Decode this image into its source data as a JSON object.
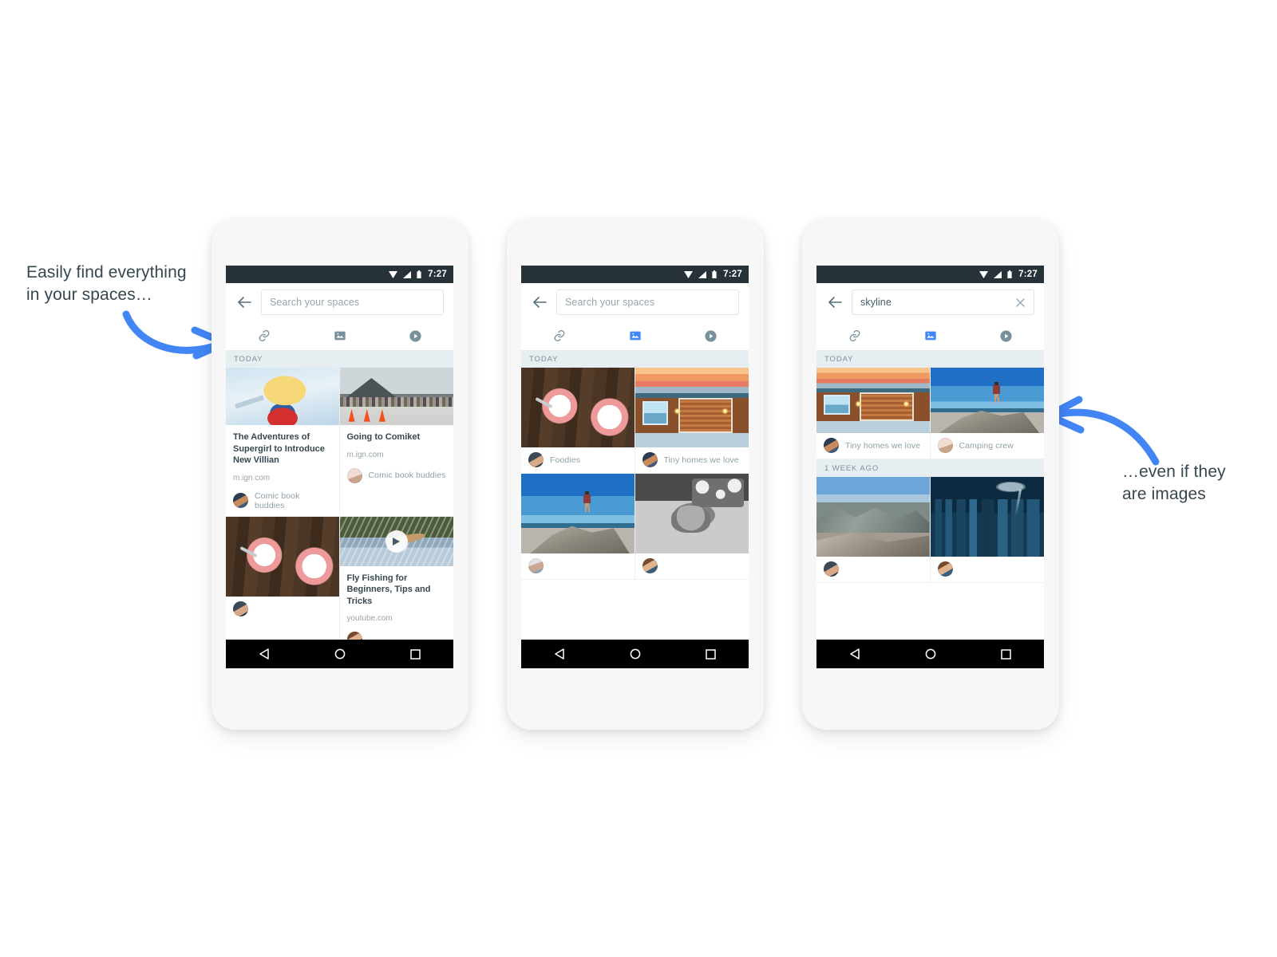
{
  "annotations": {
    "left": "Easily find everything\nin your spaces…",
    "right": "…even if they\nare images",
    "arrow_color": "#4285f4",
    "text_color": "#37474f"
  },
  "status_bar": {
    "time": "7:27",
    "icons": [
      "wifi-icon",
      "signal-icon",
      "battery-icon"
    ],
    "background": "#263238"
  },
  "nav_bar": {
    "back_label": "back-triangle",
    "home_label": "home-circle",
    "recents_label": "recents-square",
    "background": "#000000"
  },
  "tabs": {
    "link": "link-icon",
    "image": "image-icon",
    "video": "video-icon",
    "active_color": "#4285f4",
    "inactive_color": "#78909c"
  },
  "phones": [
    {
      "id": "phone-1",
      "search": {
        "value": "",
        "placeholder": "Search your spaces",
        "has_clear": false
      },
      "active_tab": "none",
      "sections": [
        {
          "label": "TODAY",
          "cards": [
            {
              "type": "link",
              "art": "art-supergirl",
              "title": "The Adventures of Supergirl to Introduce New Villian",
              "source": "m.ign.com",
              "space": "Comic book buddies",
              "avatar": "av1"
            },
            {
              "type": "link",
              "art": "art-comiket",
              "title": "Going to Comiket",
              "source": "m.ign.com",
              "space": "Comic book buddies",
              "avatar": "av2"
            },
            {
              "type": "image",
              "art": "art-food",
              "title": "",
              "source": "",
              "space": "",
              "avatar": "av3"
            },
            {
              "type": "video",
              "art": "art-fish",
              "title": "Fly Fishing for Beginners, Tips and Tricks",
              "source": "youtube.com",
              "space": "",
              "avatar": "av4"
            }
          ]
        }
      ]
    },
    {
      "id": "phone-2",
      "search": {
        "value": "",
        "placeholder": "Search your spaces",
        "has_clear": false
      },
      "active_tab": "image",
      "sections": [
        {
          "label": "TODAY",
          "cards": [
            {
              "type": "image",
              "art": "art-food",
              "title": "",
              "source": "",
              "space": "Foodies",
              "avatar": "av3"
            },
            {
              "type": "image",
              "art": "art-cabin",
              "title": "",
              "source": "",
              "space": "Tiny homes we love",
              "avatar": "av1"
            },
            {
              "type": "image",
              "art": "art-hiker",
              "title": "",
              "source": "",
              "space": "",
              "avatar": "av5"
            },
            {
              "type": "image",
              "art": "art-cat",
              "title": "",
              "source": "",
              "space": "",
              "avatar": "av4"
            }
          ]
        }
      ]
    },
    {
      "id": "phone-3",
      "search": {
        "value": "skyline",
        "placeholder": "Search your spaces",
        "has_clear": true
      },
      "active_tab": "image",
      "sections": [
        {
          "label": "TODAY",
          "cards": [
            {
              "type": "image",
              "art": "art-cabin",
              "title": "",
              "source": "",
              "space": "Tiny homes we love",
              "avatar": "av1"
            },
            {
              "type": "image",
              "art": "art-hiker",
              "title": "",
              "source": "",
              "space": "Camping crew",
              "avatar": "av2"
            }
          ]
        },
        {
          "label": "1 WEEK AGO",
          "cards": [
            {
              "type": "image",
              "art": "art-valley",
              "title": "",
              "source": "",
              "space": "",
              "avatar": "av3"
            },
            {
              "type": "image",
              "art": "art-city",
              "title": "",
              "source": "",
              "space": "",
              "avatar": "av4"
            }
          ]
        }
      ]
    }
  ]
}
